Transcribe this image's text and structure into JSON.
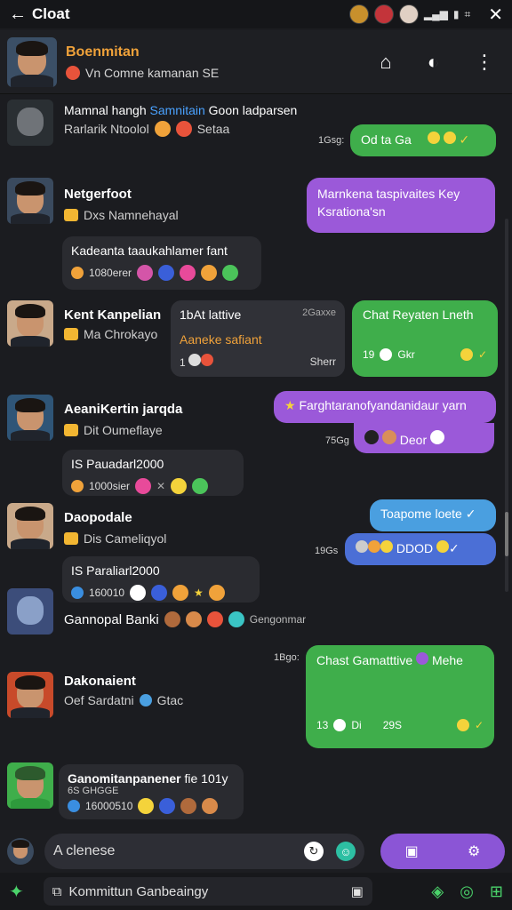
{
  "status_bar": {
    "back_icon": "←",
    "title": "Cloat",
    "close_icon": "✕"
  },
  "header": {
    "name": "Boenmitan",
    "subtitle": "Vn Comne kamanan SE",
    "actions": [
      "bag-icon",
      "mute-icon",
      "more-icon"
    ]
  },
  "messages": [
    {
      "user": "Mamnal hangh",
      "user_highlight": "Samnitain",
      "user_rest": "Goon ladparsen",
      "sub": "Rarlarik Ntoolol",
      "sub_tail": "Setaa"
    },
    {
      "bubble": "Od ta Ga",
      "time": "1Gsg:"
    },
    {
      "user": "Netgerfoot",
      "sub": "Dxs Namnehayal"
    },
    {
      "bubble": "Marnkena taspivaites Key Ksrationa'sn"
    },
    {
      "card_text": "Kadeanta taaukahlamer fant",
      "card_meta": "1080erer"
    },
    {
      "user": "Kent Kanpelian",
      "sub": "Ma Chrokayo"
    },
    {
      "card_title": "1bAt lattive",
      "card_sub": "Aaneke safiant",
      "card_right": "2Gaxxe",
      "card_meta": "1",
      "card_meta_right": "Sherr"
    },
    {
      "bubble": "Chat Reyaten Lneth",
      "meta": "19",
      "meta2": "Gkr"
    },
    {
      "user": "AeaniKertin jarqda",
      "sub": "Dit Oumeflaye"
    },
    {
      "bubble": "Farghtaranofyandanidaur yarn",
      "time": "75Gg",
      "extra": "Deor"
    },
    {
      "card_text": "IS Pauadarl2000",
      "card_meta": "1000sier"
    },
    {
      "user": "Daopodale",
      "sub": "Dis Cameliqyol"
    },
    {
      "bubble": "Toapome loete",
      "time": "19Gs",
      "extra": "DDOD"
    },
    {
      "card_text": "IS Paraliarl2000",
      "card_meta": "160010"
    },
    {
      "user": "Gannopal Banki",
      "tail": "Gengonmar"
    },
    {
      "time": "1Bgo:",
      "bubble": "Chast Gamatttive",
      "bubble_tail": "Mehe",
      "meta": "13",
      "meta2": "Di",
      "meta3": "29S"
    },
    {
      "user": "Dakonaient",
      "sub": "Oef Sardatni",
      "sub_tail": "Gtac"
    },
    {
      "user": "Ganomitanpanener",
      "user_tail": "fie 101y",
      "sub": "6S GHGGE",
      "card_meta": "16000510"
    }
  ],
  "composer": {
    "placeholder": "A clenese"
  },
  "bottom": {
    "field": "Kommittun Ganbeaingy"
  },
  "colors": {
    "green": "#3fae4b",
    "purple": "#9b59d9",
    "blue": "#4a9fe0",
    "orange": "#f0a23a"
  }
}
